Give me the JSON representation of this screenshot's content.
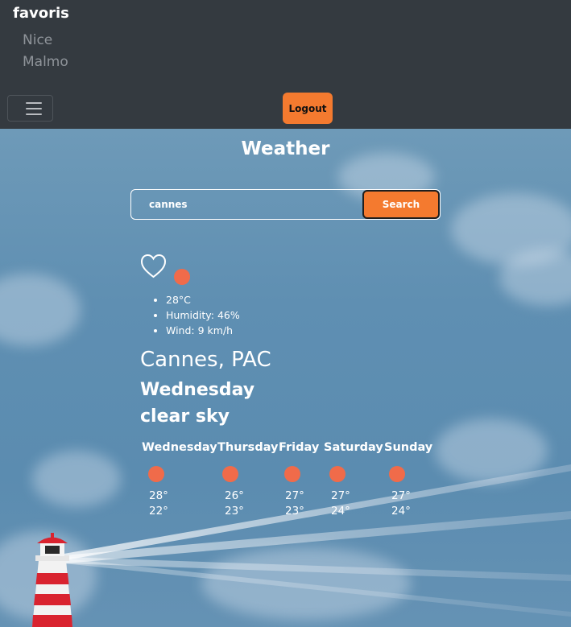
{
  "favorites": {
    "title": "favoris",
    "items": [
      "Nice",
      "Malmo"
    ]
  },
  "nav": {
    "logout_label": "Logout",
    "menu_icon": "hamburger-icon"
  },
  "page": {
    "title": "Weather"
  },
  "search": {
    "value": "cannes",
    "button_label": "Search"
  },
  "current": {
    "favorite_icon": "heart-outline-icon",
    "weather_icon": "sun-icon",
    "temperature": "28°C",
    "humidity": "Humidity: 46%",
    "wind": "Wind: 9 km/h",
    "location": "Cannes, PAC",
    "day": "Wednesday",
    "description": "clear sky"
  },
  "forecast": [
    {
      "day": "Wednesday",
      "high": "28°",
      "low": "22°",
      "icon": "sun-icon"
    },
    {
      "day": "Thursday",
      "high": "26°",
      "low": "23°",
      "icon": "sun-icon"
    },
    {
      "day": "Friday",
      "high": "27°",
      "low": "23°",
      "icon": "sun-icon"
    },
    {
      "day": "Saturday",
      "high": "27°",
      "low": "24°",
      "icon": "sun-icon"
    },
    {
      "day": "Sunday",
      "high": "27°",
      "low": "24°",
      "icon": "sun-icon"
    }
  ],
  "colors": {
    "accent": "#f47a2f",
    "navbar": "#343a40",
    "sun": "#f06b4a"
  }
}
